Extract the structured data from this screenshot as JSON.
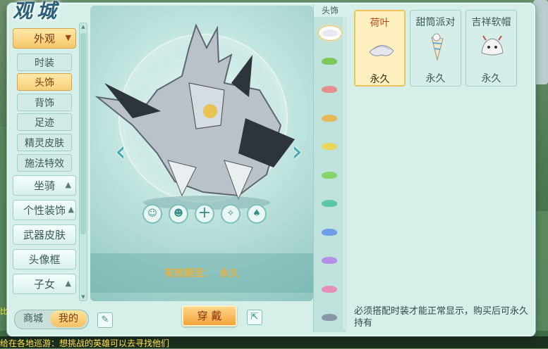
{
  "window": {
    "title_logo": "观城"
  },
  "nav": {
    "categories": [
      {
        "label": "外观",
        "active": true
      },
      {
        "label": "坐骑",
        "active": false
      },
      {
        "label": "个性装饰",
        "active": false
      },
      {
        "label": "武器皮肤",
        "active": false
      },
      {
        "label": "头像框",
        "active": false
      },
      {
        "label": "子女",
        "active": false
      }
    ],
    "subitems": [
      {
        "label": "时装",
        "active": false
      },
      {
        "label": "头饰",
        "active": true
      },
      {
        "label": "背饰",
        "active": false
      },
      {
        "label": "足迹",
        "active": false
      },
      {
        "label": "精灵皮肤",
        "active": false
      },
      {
        "label": "施法特效",
        "active": false
      }
    ]
  },
  "shop_toggle": {
    "left": "商城",
    "right": "我的"
  },
  "preview": {
    "expiry_label": "有效期至：",
    "expiry_value": "永久",
    "wear_button": "穿 戴"
  },
  "list": {
    "header": "头饰",
    "colors": [
      "#e8e8f0",
      "#7ec85a",
      "#e58f8f",
      "#e6b85a",
      "#e8d65a",
      "#86d46a",
      "#5ac8a8",
      "#6a9ee8",
      "#b58ee8",
      "#e38fb8",
      "#8a96a8"
    ]
  },
  "grid": {
    "items": [
      {
        "name": "荷叶",
        "duration": "永久",
        "selected": true
      },
      {
        "name": "甜筒派对",
        "duration": "永久",
        "selected": false
      },
      {
        "name": "吉祥软帽",
        "duration": "永久",
        "selected": false
      }
    ],
    "note": "必须搭配时装才能正常显示，购买后可永久持有"
  },
  "chat": {
    "message": "给在各地巡游：想挑战的英雄可以去寻找他们"
  },
  "side": {
    "text": "比"
  }
}
